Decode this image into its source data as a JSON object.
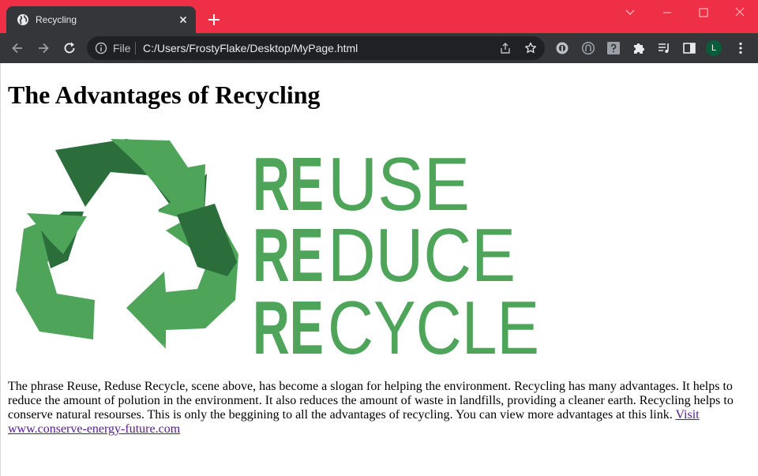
{
  "browser": {
    "tab": {
      "title": "Recycling",
      "favicon": "globe-icon"
    },
    "newtab_label": "+",
    "omnibox": {
      "scheme_label": "File",
      "url": "C:/Users/FrostyFlake/Desktop/MyPage.html"
    },
    "profile_initial": "L",
    "accent_color": "#ee2f45"
  },
  "page": {
    "heading": "The Advantages of Recycling",
    "image": {
      "slogan_words": [
        {
          "prefix": "RE",
          "suffix": "USE"
        },
        {
          "prefix": "RE",
          "suffix": "DUCE"
        },
        {
          "prefix": "RE",
          "suffix": "CYCLE"
        }
      ],
      "colors": {
        "dark_green": "#2b6e3c",
        "light_green": "#4ea55a"
      }
    },
    "paragraph": {
      "text": "The phrase Reuse, Reduse Recycle, scene above, has become a slogan for helping the environment. Recycling has many advantages. It helps to reduce the amount of polution in the environment. It also reduces the amount of waste in landfills, providing a cleaner earth. Recycling helps to conserve natural resourses. This is only the beggining to all the advantages of recycling. You can view more advantages at this link. ",
      "link_text": "Visit www.conserve-energy-future.com"
    }
  }
}
